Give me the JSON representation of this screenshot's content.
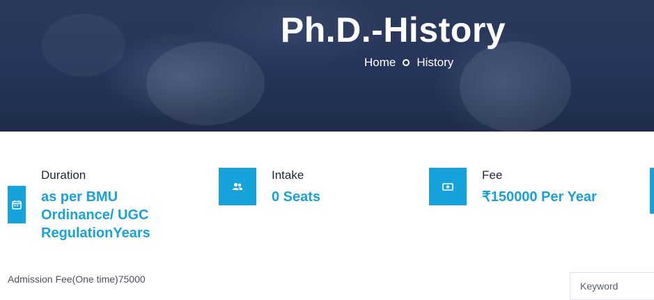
{
  "hero": {
    "title": "Ph.D.-History",
    "breadcrumb": {
      "home": "Home",
      "current": "History"
    }
  },
  "info": [
    {
      "label": "Duration",
      "value": "as per BMU Ordinance/ UGC RegulationYears",
      "icon": "calendar-icon"
    },
    {
      "label": "Intake",
      "value": "0 Seats",
      "icon": "users-icon"
    },
    {
      "label": "Fee",
      "value": "₹150000 Per Year",
      "icon": "money-icon"
    }
  ],
  "admission_fee": "Admission Fee(One time)75000",
  "search": {
    "placeholder": "Keyword"
  },
  "colors": {
    "accent": "#16a3dc",
    "hero_bg": "#26355a",
    "value_text": "#1aa1d8"
  }
}
